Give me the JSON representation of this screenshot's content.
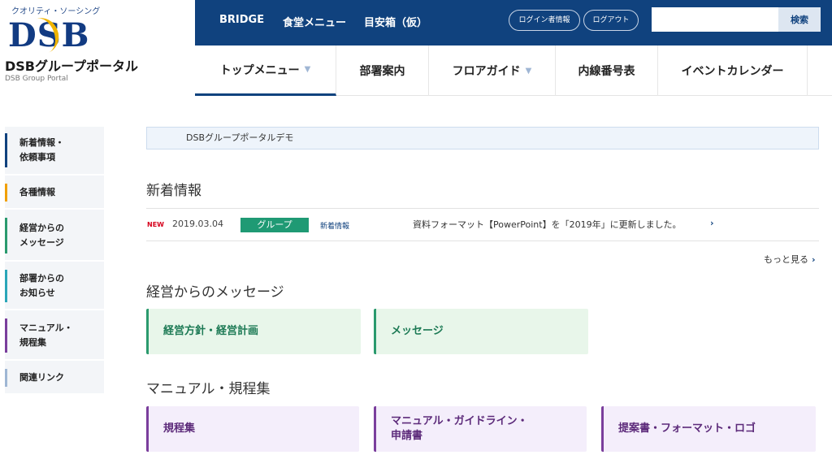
{
  "logo": {
    "tagline": "クオリティ・ソーシング",
    "mark": "DSB",
    "name": "DSBグループポータル",
    "sub": "DSB Group Portal"
  },
  "topbar": {
    "links": [
      "BRIDGE",
      "食堂メニュー",
      "目安箱（仮）"
    ],
    "login_info": "ログイン者情報",
    "logout": "ログアウト",
    "search_placeholder": "",
    "search_button": "検索"
  },
  "nav": {
    "tabs": [
      "トップメニュー",
      "部署案内",
      "フロアガイド",
      "内線番号表",
      "イベントカレンダー"
    ],
    "dropdown_arrow": "▼"
  },
  "sidebar": {
    "items": [
      {
        "label": "新着情報・\n依頼事項",
        "color": "#10427e"
      },
      {
        "label": "各種情報",
        "color": "#f0a000"
      },
      {
        "label": "経営からの\nメッセージ",
        "color": "#2a9a6e"
      },
      {
        "label": "部署からの\nお知らせ",
        "color": "#2aa6b8"
      },
      {
        "label": "マニュアル・\n規程集",
        "color": "#7a3e9c"
      },
      {
        "label": "関連リンク",
        "color": "#9fb6d4"
      }
    ]
  },
  "main": {
    "banner": "DSBグループポータルデモ",
    "news": {
      "heading": "新着情報",
      "badge": "NEW",
      "date": "2019.03.04",
      "tag": "グループ",
      "category": "新着情報",
      "text": "資料フォーマット【PowerPoint】を「2019年」に更新しました。",
      "chevron": "›",
      "more": "もっと見る",
      "more_chevron": "›"
    },
    "management": {
      "heading": "経営からのメッセージ",
      "cards": [
        "経営方針・経営計画",
        "メッセージ"
      ]
    },
    "manuals": {
      "heading": "マニュアル・規程集",
      "cards": [
        "規程集",
        "マニュアル・ガイドライン・\n申請書",
        "提案書・フォーマット・ロゴ"
      ]
    }
  }
}
